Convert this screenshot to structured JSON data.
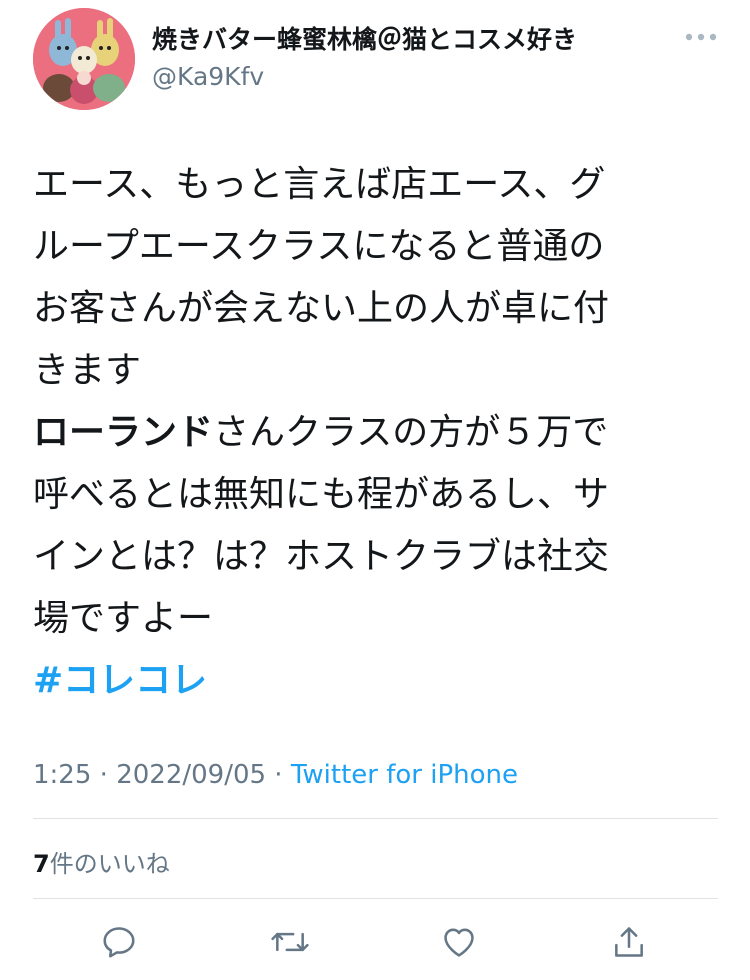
{
  "user": {
    "display_name": "焼きバター蜂蜜林檎＠猫とコスメ好き",
    "handle": "@Ka9Kfv",
    "avatar_bg": "#ec6f7f"
  },
  "header": {
    "more_icon": "more-horizontal-icon"
  },
  "tweet": {
    "line1": "エース、もっと言えば店エース、グ",
    "line2": "ループエースクラスになると普通の",
    "line3": "お客さんが会えない上の人が卓に付",
    "line4": "きます",
    "line5_bold": "ローランド",
    "line5_rest": "さんクラスの方が５万で",
    "line6": "呼べるとは無知にも程があるし、サ",
    "line7": "インとは？は？ホストクラブは社交",
    "line8": "場ですよー",
    "hashtag": "#コレコレ"
  },
  "meta": {
    "time": "1:25",
    "sep1": " · ",
    "date": "2022/09/05",
    "sep2": " · ",
    "source": "Twitter for iPhone"
  },
  "likes": {
    "count": "7",
    "label": "件のいいね"
  },
  "actions": {
    "reply_icon": "reply-icon",
    "retweet_icon": "retweet-icon",
    "like_icon": "heart-icon",
    "share_icon": "share-icon"
  },
  "colors": {
    "link": "#1da1f2",
    "secondary_text": "#657786",
    "primary_text": "#14171a",
    "divider": "#dfe3e6",
    "action_icon": "#657786"
  }
}
